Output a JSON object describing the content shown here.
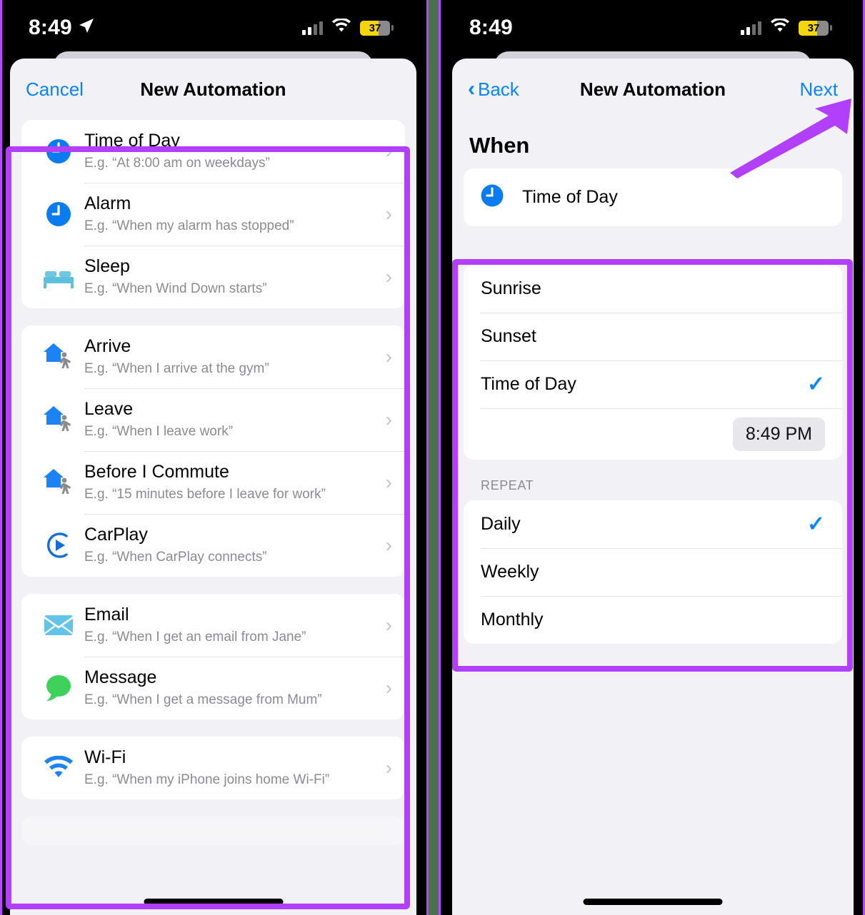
{
  "divider_color": "#4a7050",
  "accent_blue": "#0a84ff",
  "highlight_purple": "#b13ffb",
  "left": {
    "status": {
      "time": "8:49",
      "location_icon": "location-arrow-icon",
      "battery_percent": "37"
    },
    "nav": {
      "left_label": "Cancel",
      "title": "New Automation"
    },
    "groups": [
      {
        "items": [
          {
            "icon": "clock-icon",
            "title": "Time of Day",
            "subtitle": "E.g. “At 8:00 am on weekdays”"
          },
          {
            "icon": "clock-icon",
            "title": "Alarm",
            "subtitle": "E.g. “When my alarm has stopped”"
          },
          {
            "icon": "bed-icon",
            "title": "Sleep",
            "subtitle": "E.g. “When Wind Down starts”"
          }
        ]
      },
      {
        "items": [
          {
            "icon": "house-walk-icon",
            "title": "Arrive",
            "subtitle": "E.g. “When I arrive at the gym”"
          },
          {
            "icon": "house-walk-icon",
            "title": "Leave",
            "subtitle": "E.g. “When I leave work”"
          },
          {
            "icon": "house-walk-icon",
            "title": "Before I Commute",
            "subtitle": "E.g. “15 minutes before I leave for work”"
          },
          {
            "icon": "carplay-icon",
            "title": "CarPlay",
            "subtitle": "E.g. “When CarPlay connects”"
          }
        ]
      },
      {
        "items": [
          {
            "icon": "envelope-icon",
            "title": "Email",
            "subtitle": "E.g. “When I get an email from Jane”"
          },
          {
            "icon": "message-bubble-icon",
            "title": "Message",
            "subtitle": "E.g. “When I get a message from Mum”"
          }
        ]
      },
      {
        "items": [
          {
            "icon": "wifi-icon",
            "title": "Wi-Fi",
            "subtitle": "E.g. “When my iPhone joins home Wi-Fi”"
          }
        ]
      }
    ]
  },
  "right": {
    "status": {
      "time": "8:49",
      "battery_percent": "37"
    },
    "nav": {
      "back_label": "Back",
      "title": "New Automation",
      "next_label": "Next"
    },
    "section_title": "When",
    "trigger": {
      "icon": "clock-icon",
      "label": "Time of Day"
    },
    "options": [
      {
        "label": "Sunrise",
        "checked": false
      },
      {
        "label": "Sunset",
        "checked": false
      },
      {
        "label": "Time of Day",
        "checked": true
      }
    ],
    "time_value": "8:49 PM",
    "repeat_header": "REPEAT",
    "repeat_options": [
      {
        "label": "Daily",
        "checked": true
      },
      {
        "label": "Weekly",
        "checked": false
      },
      {
        "label": "Monthly",
        "checked": false
      }
    ],
    "check_glyph": "✓"
  }
}
